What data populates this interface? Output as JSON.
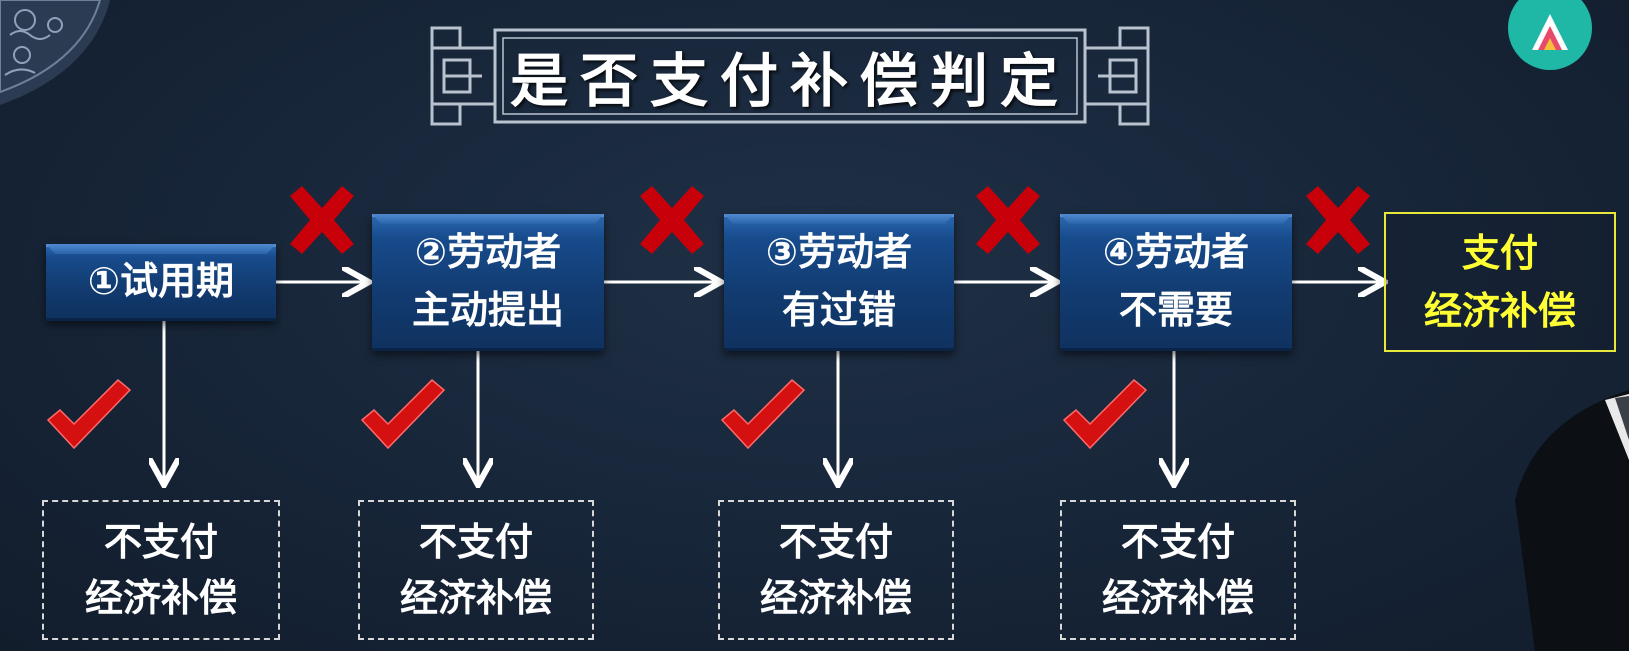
{
  "title": "是否支付补偿判定",
  "logo": {
    "text": "",
    "subtext": ""
  },
  "steps": [
    {
      "label": "①试用期"
    },
    {
      "label": "②劳动者\n主动提出"
    },
    {
      "label": "③劳动者\n有过错"
    },
    {
      "label": "④劳动者\n不需要"
    }
  ],
  "final": {
    "label": "支付\n经济补偿"
  },
  "outcomes": [
    {
      "label": "不支付\n经济补偿"
    },
    {
      "label": "不支付\n经济补偿"
    },
    {
      "label": "不支付\n经济补偿"
    },
    {
      "label": "不支付\n经济补偿"
    }
  ],
  "colors": {
    "cross": "#c8000a",
    "check": "#d41010",
    "final_text": "#ffff33",
    "arrow": "#ffffff"
  }
}
